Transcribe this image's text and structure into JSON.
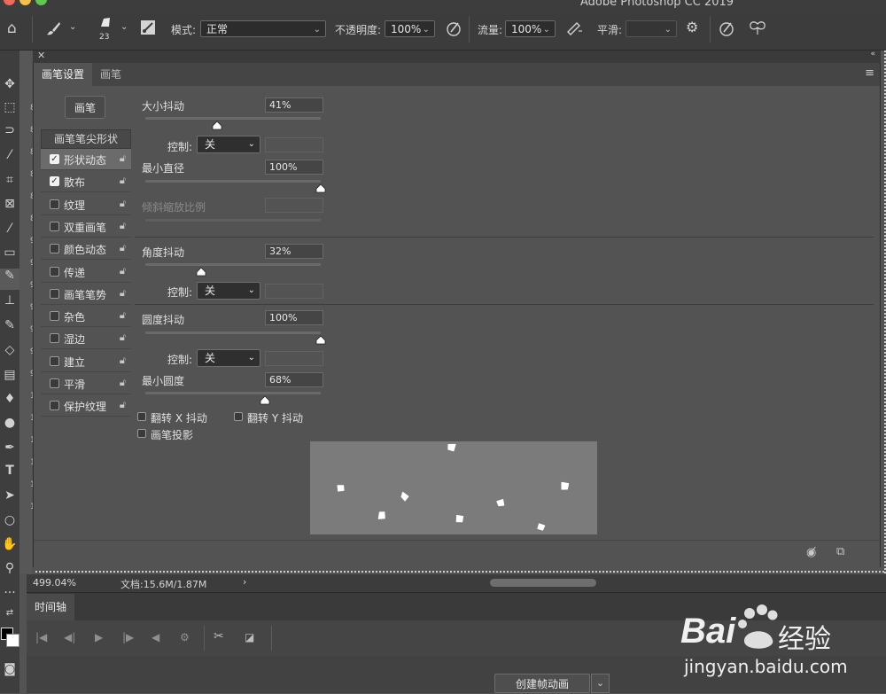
{
  "app": {
    "title": "Adobe Photoshop CC 2019"
  },
  "options_bar": {
    "brush_size": "23",
    "mode_label": "模式:",
    "mode_value": "正常",
    "opacity_label": "不透明度:",
    "opacity_value": "100%",
    "flow_label": "流量:",
    "flow_value": "100%",
    "smooth_label": "平滑:",
    "smooth_value": ""
  },
  "panel": {
    "tabs": [
      "画笔设置",
      "画笔"
    ],
    "brush_button": "画笔",
    "tip_header": "画笔笔尖形状",
    "options": [
      {
        "label": "形状动态",
        "checked": true,
        "active": true
      },
      {
        "label": "散布",
        "checked": true,
        "active": false
      },
      {
        "label": "纹理",
        "checked": false,
        "active": false
      },
      {
        "label": "双重画笔",
        "checked": false,
        "active": false
      },
      {
        "label": "颜色动态",
        "checked": false,
        "active": false
      },
      {
        "label": "传递",
        "checked": false,
        "active": false
      },
      {
        "label": "画笔笔势",
        "checked": false,
        "active": false
      },
      {
        "label": "杂色",
        "checked": false,
        "active": false
      },
      {
        "label": "湿边",
        "checked": false,
        "active": false
      },
      {
        "label": "建立",
        "checked": false,
        "active": false
      },
      {
        "label": "平滑",
        "checked": false,
        "active": false
      },
      {
        "label": "保护纹理",
        "checked": false,
        "active": false
      }
    ],
    "size_jitter": {
      "label": "大小抖动",
      "value": "41%",
      "level": 0.41
    },
    "size_control": {
      "label": "控制:",
      "value": "关"
    },
    "min_diameter": {
      "label": "最小直径",
      "value": "100%",
      "level": 1.0
    },
    "tilt_scale": {
      "label": "倾斜缩放比例"
    },
    "angle_jitter": {
      "label": "角度抖动",
      "value": "32%",
      "level": 0.32
    },
    "angle_control": {
      "label": "控制:",
      "value": "关"
    },
    "roundness_jitter": {
      "label": "圆度抖动",
      "value": "100%",
      "level": 1.0
    },
    "roundness_control": {
      "label": "控制:",
      "value": "关"
    },
    "min_roundness": {
      "label": "最小圆度",
      "value": "68%",
      "level": 0.68
    },
    "flip_x": "翻转 X 抖动",
    "flip_y": "翻转 Y 抖动",
    "brush_projection": "画笔投影"
  },
  "status": {
    "zoom": "499.04%",
    "doc": "文档:15.6M/1.87M"
  },
  "timeline": {
    "tab": "时间轴",
    "create_button": "创建帧动画"
  },
  "watermark": {
    "brand": "Bai",
    "brand_cn": "经验",
    "url": "jingyan.baidu.com"
  },
  "colors": {
    "panel_bg": "#535353",
    "bar_bg": "#3c3c3c",
    "preview_bg": "#7b7b7b"
  },
  "ruler_marks": [
    "8",
    "8",
    "8",
    "8",
    "8",
    "8",
    "9",
    "9",
    "9",
    "9",
    "9",
    "9",
    "9",
    "1",
    "1",
    "1",
    "1",
    "1",
    "1"
  ]
}
